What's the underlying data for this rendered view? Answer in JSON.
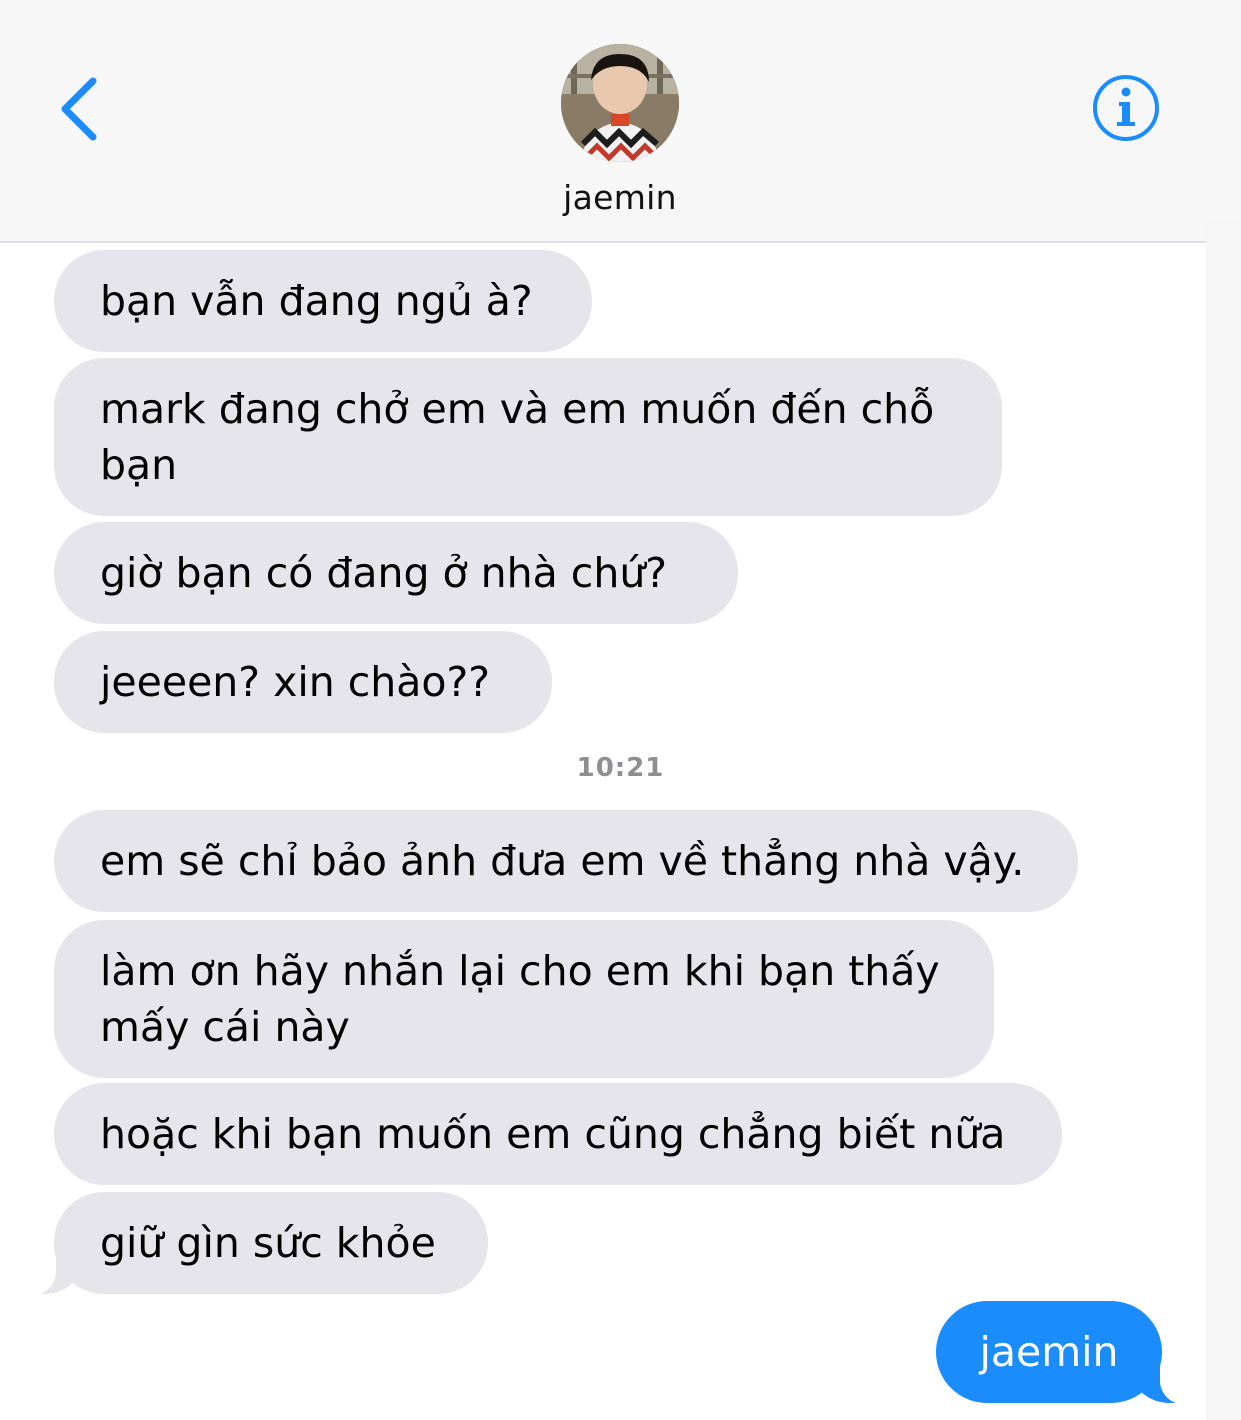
{
  "header": {
    "contact_name": "jaemin",
    "back_icon": "chevron-left-icon",
    "info_icon": "info-circle-icon",
    "accent_color": "#1a8cfb"
  },
  "thread": {
    "received": [
      "bạn vẫn đang ngủ à?",
      "mark đang chở em và em muốn đến chỗ bạn",
      "giờ bạn có đang ở nhà chứ?",
      "jeeeen? xin chào??",
      "em sẽ chỉ bảo ảnh đưa em về thẳng nhà vậy.",
      "làm ơn hãy nhắn lại cho em khi bạn thấy mấy cái này",
      "hoặc khi bạn muốn em cũng chẳng biết nữa",
      "giữ gìn sức khỏe"
    ],
    "timestamp": "10:21",
    "sent": [
      "jaemin"
    ]
  }
}
